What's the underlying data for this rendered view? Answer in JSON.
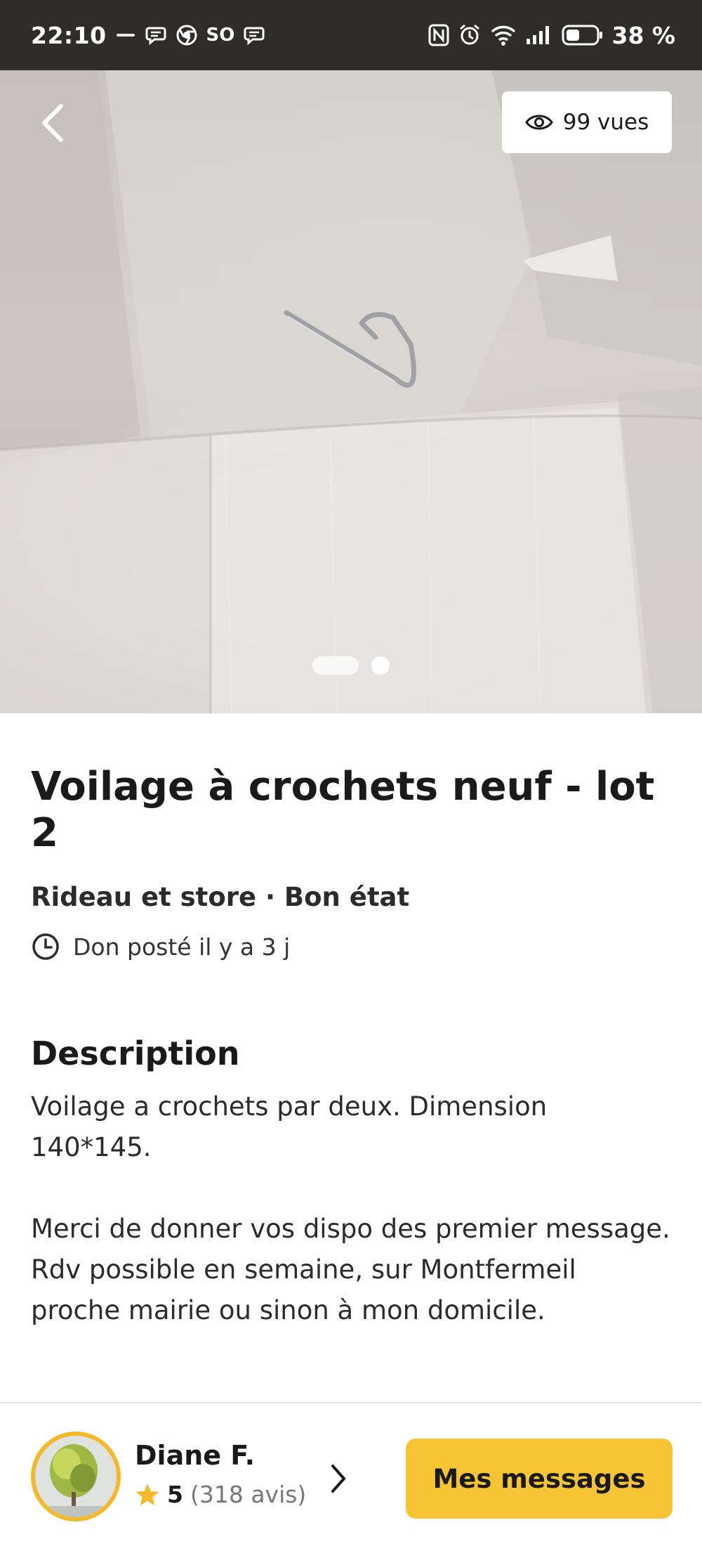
{
  "status_bar": {
    "time": "22:10",
    "notif_text_icon": "SO",
    "battery_percent": "38 %"
  },
  "listing": {
    "views_label": "99 vues",
    "image_count": 2,
    "active_image_index": 0,
    "title": "Voilage à crochets neuf - lot 2",
    "meta": "Rideau et store · Bon état",
    "posted": "Don posté il y a 3 j"
  },
  "description": {
    "heading": "Description",
    "body": "Voilage a crochets par deux. Dimension 140*145.\n\nMerci de donner vos dispo des premier message.\nRdv possible en semaine, sur Montfermeil proche mairie ou sinon à mon domicile."
  },
  "seller": {
    "name": "Diane F.",
    "rating": "5",
    "reviews": "(318 avis)"
  },
  "actions": {
    "messages_label": "Mes messages"
  },
  "colors": {
    "accent": "#f6c434",
    "avatar_ring": "#f4b92a",
    "star": "#f4b92a"
  },
  "icons": [
    "back-arrow-icon",
    "eye-icon",
    "clock-icon",
    "star-icon",
    "chevron-right-icon",
    "nfc-icon",
    "alarm-icon",
    "wifi-icon",
    "signal-icon",
    "battery-icon",
    "chat-icon",
    "chrome-icon"
  ]
}
